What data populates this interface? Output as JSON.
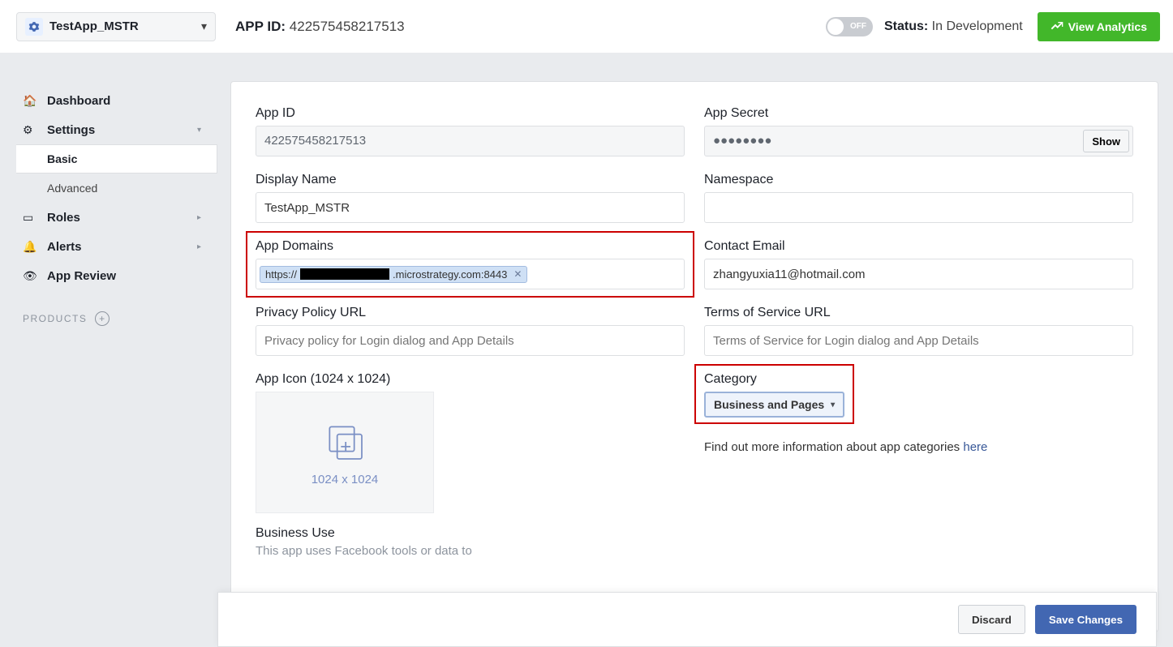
{
  "header": {
    "app_name": "TestApp_MSTR",
    "app_id_label": "APP ID:",
    "app_id": "422575458217513",
    "toggle_off_label": "OFF",
    "status_label": "Status:",
    "status_value": "In Development",
    "view_analytics": "View Analytics"
  },
  "sidebar": {
    "dashboard": "Dashboard",
    "settings": "Settings",
    "basic": "Basic",
    "advanced": "Advanced",
    "roles": "Roles",
    "alerts": "Alerts",
    "app_review": "App Review",
    "products": "PRODUCTS"
  },
  "form": {
    "app_id_label": "App ID",
    "app_id_value": "422575458217513",
    "app_secret_label": "App Secret",
    "app_secret_value": "●●●●●●●●",
    "show_button": "Show",
    "display_name_label": "Display Name",
    "display_name_value": "TestApp_MSTR",
    "namespace_label": "Namespace",
    "namespace_value": "",
    "app_domains_label": "App Domains",
    "domain_prefix": "https://",
    "domain_suffix": ".microstrategy.com:8443",
    "contact_email_label": "Contact Email",
    "contact_email_value": "zhangyuxia11@hotmail.com",
    "privacy_label": "Privacy Policy URL",
    "privacy_placeholder": "Privacy policy for Login dialog and App Details",
    "tos_label": "Terms of Service URL",
    "tos_placeholder": "Terms of Service for Login dialog and App Details",
    "appicon_label": "App Icon (1024 x 1024)",
    "appicon_dim": "1024 x 1024",
    "category_label": "Category",
    "category_selected": "Business and Pages",
    "category_hint_text": "Find out more information about app categories ",
    "category_hint_link": "here",
    "business_use_label": "Business Use",
    "business_use_sub": "This app uses Facebook tools or data to"
  },
  "footer": {
    "discard": "Discard",
    "save": "Save Changes"
  }
}
